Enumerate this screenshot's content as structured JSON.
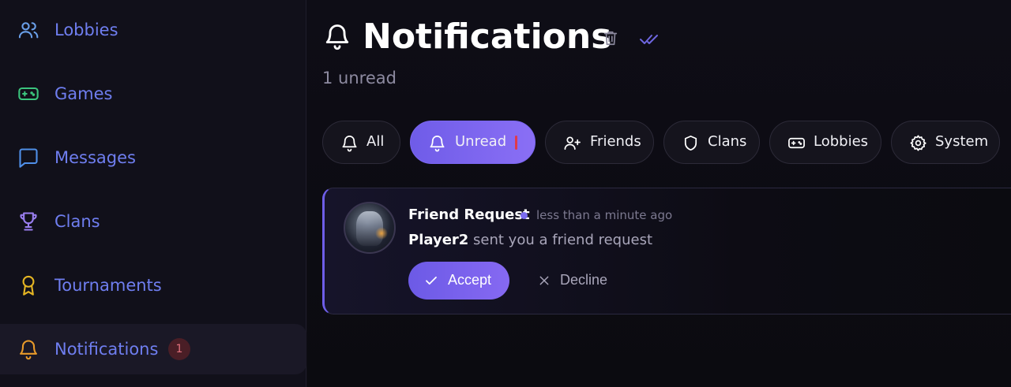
{
  "sidebar": {
    "items": [
      {
        "label": "Lobbies",
        "icon": "users-icon",
        "color": "#6aa0ea",
        "label_color": "#6f7ef0"
      },
      {
        "label": "Games",
        "icon": "gamepad-icon",
        "color": "#3bc47d",
        "label_color": "#6f7ef0"
      },
      {
        "label": "Messages",
        "icon": "message-square-icon",
        "color": "#4f8fe8",
        "label_color": "#6f7ef0"
      },
      {
        "label": "Clans",
        "icon": "trophy-icon",
        "color": "#9a7ef0",
        "label_color": "#6f7ef0"
      },
      {
        "label": "Tournaments",
        "icon": "award-icon",
        "color": "#e5b523",
        "label_color": "#6f7ef0"
      },
      {
        "label": "Notifications",
        "icon": "bell-icon",
        "color": "#e89a2a",
        "label_color": "#6f7ef0",
        "badge": "1"
      }
    ]
  },
  "header": {
    "title": "Notifications",
    "unread_text": "1 unread"
  },
  "filters": [
    {
      "label": "All",
      "icon": "bell-icon"
    },
    {
      "label": "Unread",
      "icon": "bell-icon",
      "active": true
    },
    {
      "label": "Friends",
      "icon": "user-plus-icon"
    },
    {
      "label": "Clans",
      "icon": "shield-icon"
    },
    {
      "label": "Lobbies",
      "icon": "gamepad-icon"
    },
    {
      "label": "System",
      "icon": "gear-icon"
    }
  ],
  "notification": {
    "title": "Friend Request",
    "time": "less than a minute ago",
    "sender": "Player2",
    "message": "sent you a friend request",
    "accept_label": "Accept",
    "decline_label": "Decline"
  },
  "colors": {
    "accent": "#7b6cf0",
    "background": "#0e0d15"
  }
}
